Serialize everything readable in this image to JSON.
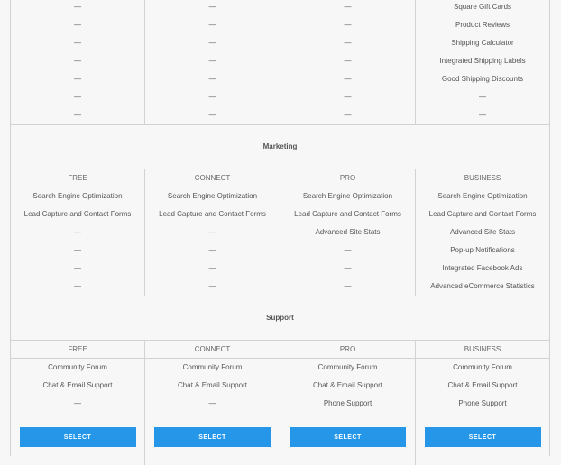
{
  "top_table": {
    "columns": [
      [
        "—",
        "—",
        "—",
        "—",
        "—",
        "—",
        "—"
      ],
      [
        "—",
        "—",
        "—",
        "—",
        "—",
        "—",
        "—"
      ],
      [
        "—",
        "—",
        "—",
        "—",
        "—",
        "—",
        "—"
      ],
      [
        "Square Gift Cards",
        "Product Reviews",
        "Shipping Calculator",
        "Integrated Shipping Labels",
        "Good Shipping Discounts",
        "—",
        "—"
      ]
    ]
  },
  "marketing": {
    "title": "Marketing",
    "tiers": [
      "FREE",
      "CONNECT",
      "PRO",
      "BUSINESS"
    ],
    "columns": [
      [
        "Search Engine Optimization",
        "Lead Capture and Contact Forms",
        "—",
        "—",
        "—",
        "—"
      ],
      [
        "Search Engine Optimization",
        "Lead Capture and Contact Forms",
        "—",
        "—",
        "—",
        "—"
      ],
      [
        "Search Engine Optimization",
        "Lead Capture and Contact Forms",
        "Advanced Site Stats",
        "—",
        "—",
        "—"
      ],
      [
        "Search Engine Optimization",
        "Lead Capture and Contact Forms",
        "Advanced Site Stats",
        "Pop-up Notifications",
        "Integrated Facebook Ads",
        "Advanced eCommerce Statistics"
      ]
    ]
  },
  "support": {
    "title": "Support",
    "tiers": [
      "FREE",
      "CONNECT",
      "PRO",
      "BUSINESS"
    ],
    "columns": [
      [
        "Community Forum",
        "Chat & Email Support",
        "—"
      ],
      [
        "Community Forum",
        "Chat & Email Support",
        "—"
      ],
      [
        "Community Forum",
        "Chat & Email Support",
        "Phone Support"
      ],
      [
        "Community Forum",
        "Chat & Email Support",
        "Phone Support"
      ]
    ]
  },
  "buttons": [
    "SELECT",
    "SELECT",
    "SELECT",
    "SELECT"
  ],
  "colors": {
    "accent": "#2596e8",
    "border": "#d2d2d2",
    "background": "#f7f7f7"
  }
}
